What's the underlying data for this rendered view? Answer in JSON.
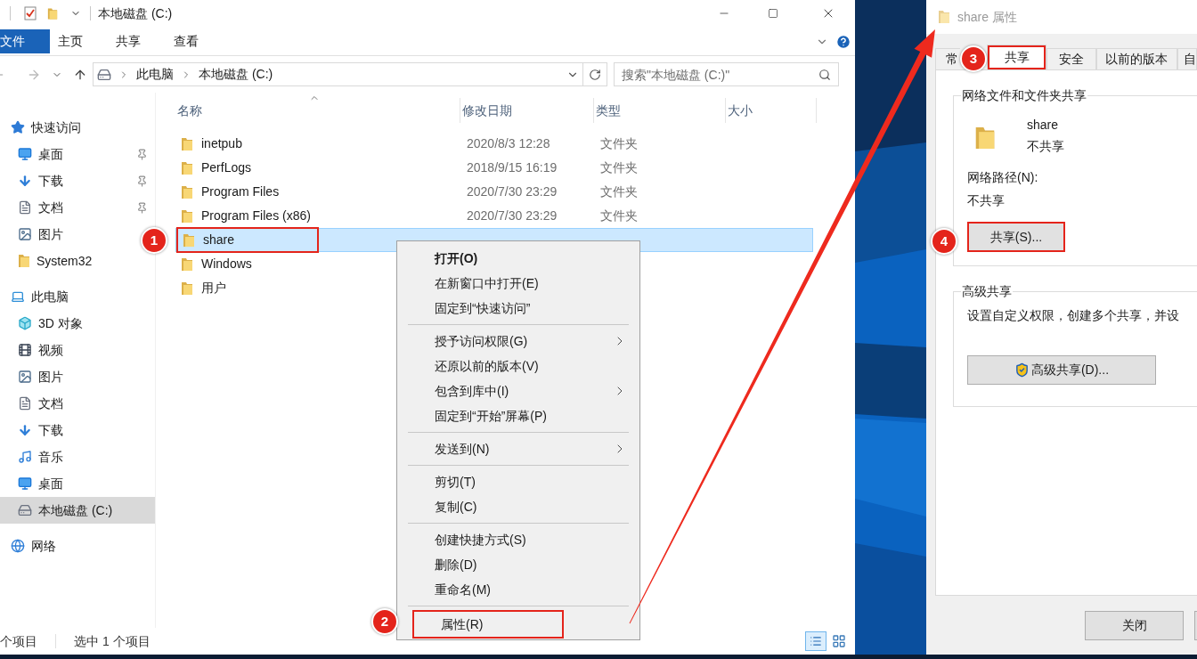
{
  "explorer": {
    "title": "本地磁盘 (C:)",
    "ribbon_tabs": [
      {
        "label": "文件",
        "kind": "file"
      },
      {
        "label": "主页",
        "kind": "tab"
      },
      {
        "label": "共享",
        "kind": "tab"
      },
      {
        "label": "查看",
        "kind": "tab"
      }
    ],
    "breadcrumbs": [
      "此电脑",
      "本地磁盘 (C:)"
    ],
    "search": {
      "placeholder": "搜索\"本地磁盘 (C:)\""
    },
    "nav": [
      {
        "label": "快速访问",
        "kind": "star",
        "selected": false,
        "children": [
          {
            "label": "桌面",
            "kind": "desktop",
            "pinned": true,
            "selected": false
          },
          {
            "label": "下载",
            "kind": "download",
            "pinned": true,
            "selected": false
          },
          {
            "label": "文档",
            "kind": "document",
            "pinned": true,
            "selected": false
          },
          {
            "label": "图片",
            "kind": "picture",
            "pinned": false,
            "selected": false
          },
          {
            "label": "System32",
            "kind": "folder",
            "pinned": false,
            "selected": false
          }
        ]
      },
      {
        "label": "此电脑",
        "kind": "pc",
        "selected": false,
        "children": [
          {
            "label": "3D 对象",
            "kind": "cube",
            "pinned": false,
            "selected": false
          },
          {
            "label": "视频",
            "kind": "video",
            "pinned": false,
            "selected": false
          },
          {
            "label": "图片",
            "kind": "picture",
            "pinned": false,
            "selected": false
          },
          {
            "label": "文档",
            "kind": "document",
            "pinned": false,
            "selected": false
          },
          {
            "label": "下载",
            "kind": "download",
            "pinned": false,
            "selected": false
          },
          {
            "label": "音乐",
            "kind": "music",
            "pinned": false,
            "selected": false
          },
          {
            "label": "桌面",
            "kind": "desktop",
            "pinned": false,
            "selected": false
          },
          {
            "label": "本地磁盘 (C:)",
            "kind": "drive",
            "pinned": false,
            "selected": true
          }
        ]
      },
      {
        "label": "网络",
        "kind": "network",
        "selected": false
      }
    ],
    "columns": [
      "名称",
      "修改日期",
      "类型",
      "大小"
    ],
    "rows": [
      {
        "name": "inetpub",
        "date": "2020/8/3 12:28",
        "type": "文件夹",
        "selected": false,
        "highlight": false
      },
      {
        "name": "PerfLogs",
        "date": "2018/9/15 16:19",
        "type": "文件夹",
        "selected": false,
        "highlight": false
      },
      {
        "name": "Program Files",
        "date": "2020/7/30 23:29",
        "type": "文件夹",
        "selected": false,
        "highlight": false
      },
      {
        "name": "Program Files (x86)",
        "date": "2020/7/30 23:29",
        "type": "文件夹",
        "selected": false,
        "highlight": false
      },
      {
        "name": "share",
        "selected": true,
        "highlight": true
      },
      {
        "name": "Windows",
        "selected": false,
        "highlight": false
      },
      {
        "name": "用户",
        "selected": false,
        "highlight": false
      }
    ],
    "status": [
      "个项目",
      "选中 1 个项目"
    ]
  },
  "context_menu": {
    "groups": [
      [
        {
          "label": "打开(O)",
          "bold": true,
          "submenu": false,
          "highlight": false
        },
        {
          "label": "在新窗口中打开(E)",
          "bold": false,
          "submenu": false,
          "highlight": false
        },
        {
          "label": "固定到“快速访问”",
          "bold": false,
          "submenu": false,
          "highlight": false
        }
      ],
      [
        {
          "label": "授予访问权限(G)",
          "bold": false,
          "submenu": true,
          "highlight": false
        },
        {
          "label": "还原以前的版本(V)",
          "bold": false,
          "submenu": false,
          "highlight": false
        },
        {
          "label": "包含到库中(I)",
          "bold": false,
          "submenu": true,
          "highlight": false
        },
        {
          "label": "固定到“开始”屏幕(P)",
          "bold": false,
          "submenu": false,
          "highlight": false
        }
      ],
      [
        {
          "label": "发送到(N)",
          "bold": false,
          "submenu": true,
          "highlight": false
        }
      ],
      [
        {
          "label": "剪切(T)",
          "bold": false,
          "submenu": false,
          "highlight": false
        },
        {
          "label": "复制(C)",
          "bold": false,
          "submenu": false,
          "highlight": false
        }
      ],
      [
        {
          "label": "创建快捷方式(S)",
          "bold": false,
          "submenu": false,
          "highlight": false
        },
        {
          "label": "删除(D)",
          "bold": false,
          "submenu": false,
          "highlight": false
        },
        {
          "label": "重命名(M)",
          "bold": false,
          "submenu": false,
          "highlight": false
        }
      ],
      [
        {
          "label": "属性(R)",
          "bold": false,
          "submenu": false,
          "highlight": true
        }
      ]
    ]
  },
  "dialog": {
    "title": "share 属性",
    "tabs": [
      {
        "label": "常",
        "selected": false,
        "highlight": false
      },
      {
        "label": "共享",
        "selected": true,
        "highlight": true
      },
      {
        "label": "安全",
        "selected": false,
        "highlight": false
      },
      {
        "label": "以前的版本",
        "selected": false,
        "highlight": false
      },
      {
        "label": "自",
        "selected": false,
        "highlight": false
      }
    ],
    "sharing": {
      "title": "网络文件和文件夹共享",
      "name": "share",
      "status": "不共享",
      "path_label": "网络路径(N):",
      "path_value": "不共享",
      "button": {
        "label": "共享(S)...",
        "highlight": true
      }
    },
    "advanced": {
      "title": "高级共享",
      "text": "设置自定义权限，创建多个共享，并设",
      "button": {
        "label": "高级共享(D)..."
      }
    },
    "buttons": [
      "关闭"
    ]
  },
  "annotations": [
    {
      "label": "1"
    },
    {
      "label": "2"
    },
    {
      "label": "3"
    },
    {
      "label": "4"
    }
  ]
}
